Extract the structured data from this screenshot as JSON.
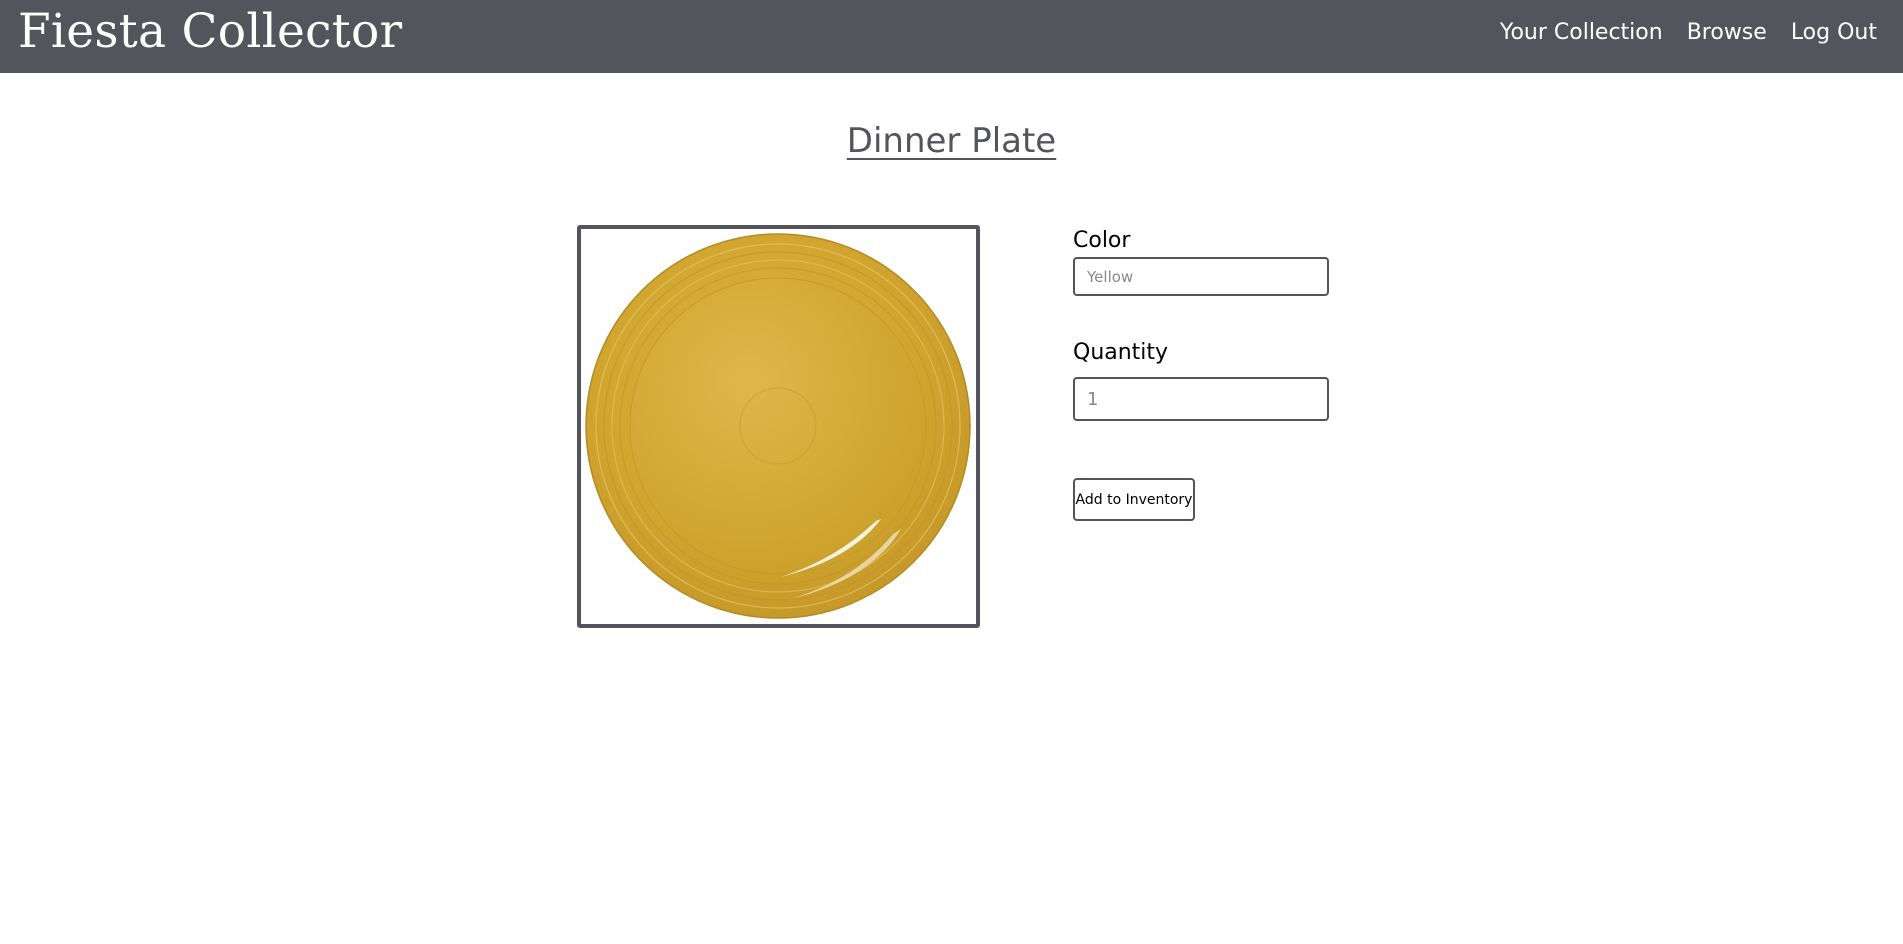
{
  "header": {
    "brand": "Fiesta Collector",
    "nav": [
      {
        "label": "Your Collection"
      },
      {
        "label": "Browse"
      },
      {
        "label": "Log Out"
      }
    ],
    "bg_color": "#54555c"
  },
  "main": {
    "title": "Dinner Plate",
    "image": {
      "icon": "yellow-dinner-plate",
      "color": "#d4a938"
    },
    "form": {
      "color_label": "Color",
      "color_placeholder": "Yellow",
      "color_value": "",
      "quantity_label": "Quantity",
      "quantity_value": "1",
      "submit_label": "Add to Inventory"
    }
  }
}
